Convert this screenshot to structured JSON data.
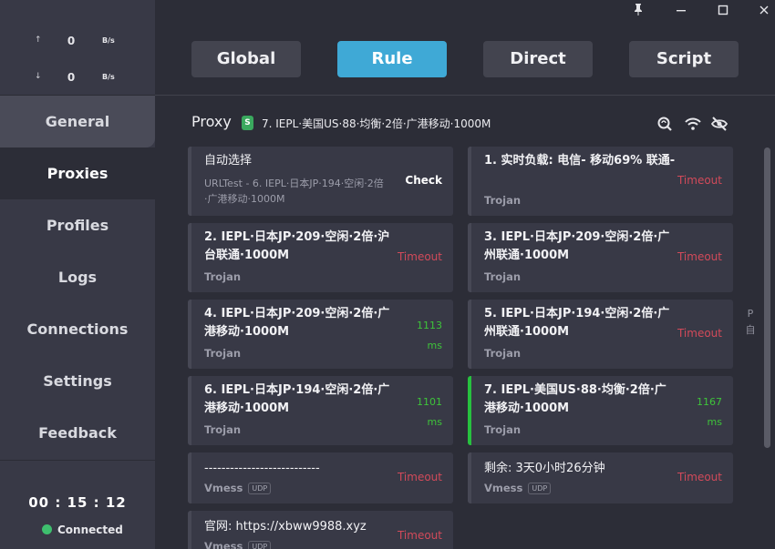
{
  "window": {
    "controls": [
      {
        "name": "pin-icon",
        "glyph": "📌"
      },
      {
        "name": "minimize-icon",
        "glyph": "–"
      },
      {
        "name": "maximize-icon",
        "glyph": "☐"
      },
      {
        "name": "close-icon",
        "glyph": "✕"
      }
    ]
  },
  "traffic": {
    "upload": {
      "arrow": "↑",
      "value": "0",
      "unit": "B/s"
    },
    "download": {
      "arrow": "↓",
      "value": "0",
      "unit": "B/s"
    }
  },
  "sidebar": {
    "items": [
      {
        "label": "General"
      },
      {
        "label": "Proxies"
      },
      {
        "label": "Profiles"
      },
      {
        "label": "Logs"
      },
      {
        "label": "Connections"
      },
      {
        "label": "Settings"
      },
      {
        "label": "Feedback"
      }
    ],
    "active": "Proxies"
  },
  "status": {
    "uptime": "00 : 15 : 12",
    "connection": "Connected",
    "connection_color": "#3ebf6e"
  },
  "modes": {
    "items": [
      {
        "label": "Global"
      },
      {
        "label": "Rule"
      },
      {
        "label": "Direct"
      },
      {
        "label": "Script"
      }
    ],
    "active": "Rule",
    "active_color": "#3fa9d6"
  },
  "proxy_group": {
    "title": "Proxy",
    "badge": "S",
    "current": "7. IEPL·美国US·88·均衡·2倍·广港移动·1000M",
    "icons": [
      "latency-test-icon",
      "wifi-icon",
      "hide-icon"
    ]
  },
  "proxies": [
    {
      "name": "自动选择",
      "sub": "URLTest - 6. IEPL·日本JP·194·空闲·2倍·广港移动·1000M",
      "status": "Check"
    },
    {
      "name": "1. 实时负载: 电信- 移动69% 联通-",
      "sub": "Trojan",
      "status": "Timeout"
    },
    {
      "name": "2. IEPL·日本JP·209·空闲·2倍·沪台联通·1000M",
      "sub": "Trojan",
      "status": "Timeout"
    },
    {
      "name": "3. IEPL·日本JP·209·空闲·2倍·广州联通·1000M",
      "sub": "Trojan",
      "status": "Timeout"
    },
    {
      "name": "4. IEPL·日本JP·209·空闲·2倍·广港移动·1000M",
      "sub": "Trojan",
      "status": "1113",
      "unit": "ms"
    },
    {
      "name": "5. IEPL·日本JP·194·空闲·2倍·广州联通·1000M",
      "sub": "Trojan",
      "status": "Timeout"
    },
    {
      "name": "6. IEPL·日本JP·194·空闲·2倍·广港移动·1000M",
      "sub": "Trojan",
      "status": "1101",
      "unit": "ms"
    },
    {
      "name": "7. IEPL·美国US·88·均衡·2倍·广港移动·1000M",
      "sub": "Trojan",
      "status": "1167",
      "unit": "ms",
      "selected": true
    },
    {
      "name": "---------------------------",
      "sub": "Vmess",
      "tag": "UDP",
      "status": "Timeout"
    },
    {
      "name": "剩余: 3天0小时26分钟",
      "sub": "Vmess",
      "tag": "UDP",
      "status": "Timeout"
    },
    {
      "name": "官网: https://xbww9988.xyz",
      "sub": "Vmess",
      "tag": "UDP",
      "status": "Timeout"
    }
  ],
  "side_hint": [
    "P",
    "自"
  ],
  "colors": {
    "timeout": "#d24a5a",
    "latency": "#3ec43a",
    "selected_bar": "#27c13f"
  }
}
